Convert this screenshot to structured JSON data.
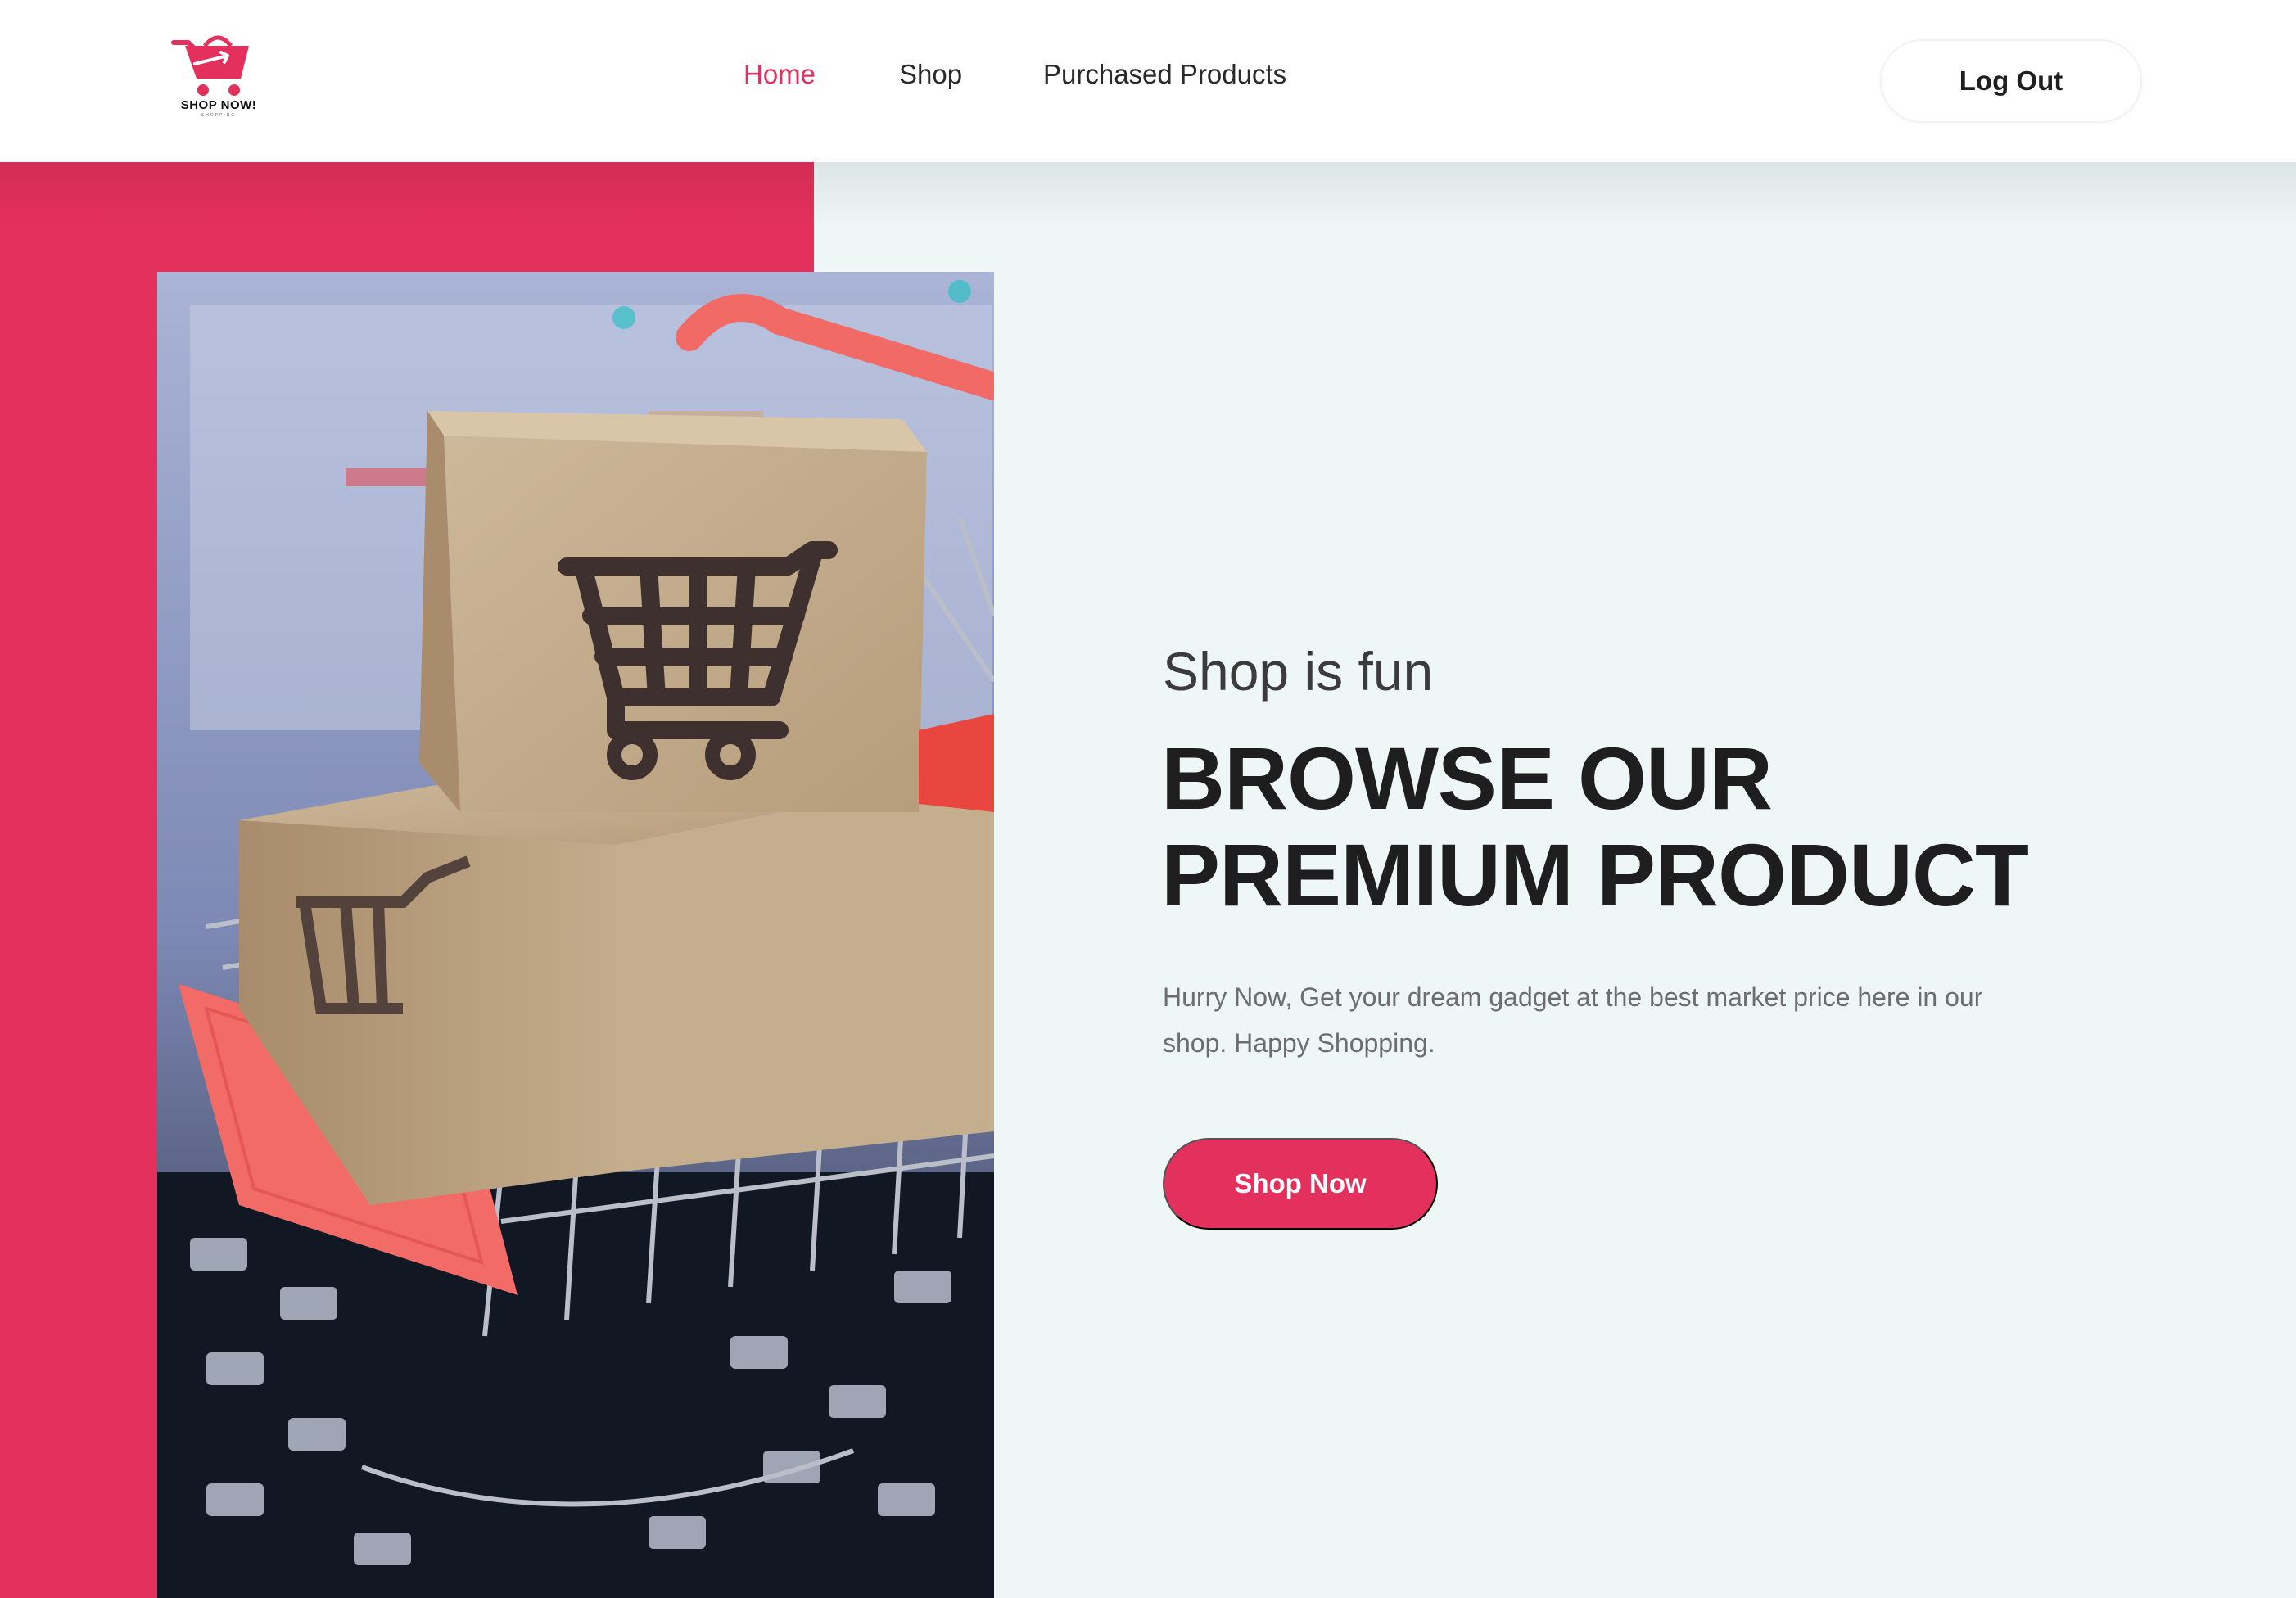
{
  "brand": {
    "name": "SHOP NOW!",
    "tagline": "SHOPPING",
    "accent_color": "#e3305c"
  },
  "nav": {
    "items": [
      {
        "label": "Home",
        "active": true
      },
      {
        "label": "Shop",
        "active": false
      },
      {
        "label": "Purchased Products",
        "active": false
      }
    ],
    "logout_label": "Log Out"
  },
  "hero": {
    "eyebrow": "Shop is fun",
    "headline_line1": "BROWSE OUR",
    "headline_line2": "PREMIUM PRODUCT",
    "description": "Hurry Now, Get your dream gadget at the best market price here in our shop. Happy Shopping.",
    "cta_label": "Shop Now",
    "image_alt": "shopping-cart-with-boxes-on-keyboard"
  }
}
